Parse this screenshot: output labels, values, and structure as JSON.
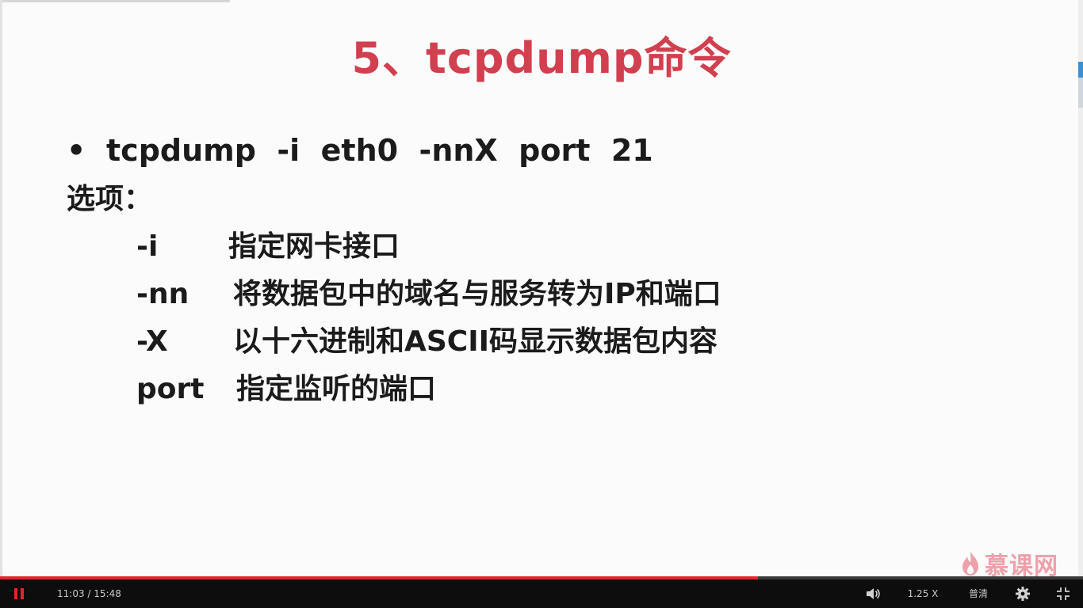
{
  "slide": {
    "title": "5、tcpdump命令",
    "bullet_symbol": "•",
    "command": "tcpdump  -i  eth0  -nnX  port  21",
    "options_label": "选项：",
    "options": [
      {
        "flag": "-i",
        "description": "指定网卡接口"
      },
      {
        "flag": "-nn",
        "description": "将数据包中的域名与服务转为IP和端口"
      },
      {
        "flag": "-X",
        "description": "以十六进制和ASCII码显示数据包内容"
      },
      {
        "flag": "port",
        "description": "指定监听的端口"
      }
    ],
    "watermark_text": "慕课网"
  },
  "player": {
    "progress_percent": 70,
    "current_time": "11:03",
    "duration": "15:48",
    "time_separator": " / ",
    "speed_label": "1.25 X",
    "quality_label": "普清",
    "pause_icon": "pause-icon",
    "volume_icon": "volume-icon",
    "settings_icon": "gear-icon",
    "fullscreen_icon": "exit-fullscreen-icon",
    "accent_color": "#e0262c",
    "title_color": "#d0404f"
  }
}
